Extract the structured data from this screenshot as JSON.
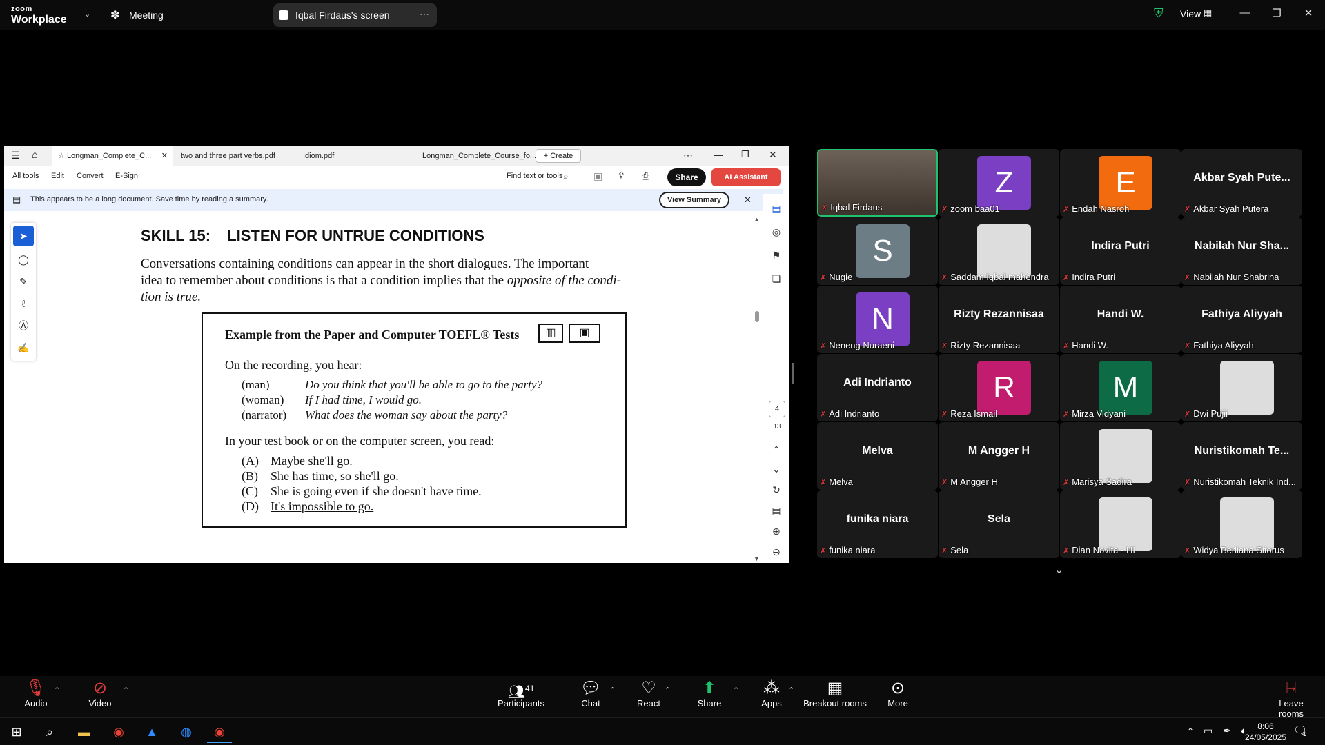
{
  "zoom": {
    "logo_line1": "zoom",
    "logo_line2": "Workplace",
    "meeting_label": "Meeting",
    "share_title": "Iqbal Firdaus's screen",
    "view_label": "View"
  },
  "acrobat": {
    "tabs": [
      "Longman_Complete_C...",
      "two and three part verbs.pdf",
      "Idiom.pdf",
      "Longman_Complete_Course_fo..."
    ],
    "create_label": "Create",
    "menu": [
      "All tools",
      "Edit",
      "Convert",
      "E-Sign"
    ],
    "find_label": "Find text or tools",
    "share_label": "Share",
    "ai_label": "AI Assistant",
    "banner_text": "This appears to be a long document. Save time by reading a summary.",
    "summary_label": "View Summary",
    "page_current": "4",
    "page_total": "13"
  },
  "document": {
    "skill_heading": "SKILL 15:",
    "skill_title": "LISTEN FOR UNTRUE CONDITIONS",
    "intro_1": "Conversations containing conditions can appear in the short dialogues. The important",
    "intro_2a": "idea to remember about conditions is that a condition implies that the ",
    "intro_2b": "opposite of the condi-",
    "intro_3": "tion is true.",
    "example_title": "Example from the Paper and Computer TOEFL® Tests",
    "recording_label": "On the recording, you hear:",
    "dialogue": [
      {
        "speaker": "(man)",
        "line": "Do you think that you'll be able to go to the party?"
      },
      {
        "speaker": "(woman)",
        "line": "If I had time, I would go."
      },
      {
        "speaker": "(narrator)",
        "line": "What does the woman say about the party?"
      }
    ],
    "read_label": "In your test book or on the computer screen, you read:",
    "options": [
      {
        "letter": "(A)",
        "text": "Maybe she'll go."
      },
      {
        "letter": "(B)",
        "text": "She has time, so she'll go."
      },
      {
        "letter": "(C)",
        "text": "She is going even if she doesn't have time."
      },
      {
        "letter": "(D)",
        "text": "It's impossible to go."
      }
    ]
  },
  "participants": [
    {
      "name": "Iqbal Firdaus",
      "type": "video"
    },
    {
      "name": "zoom baa01",
      "type": "avatar",
      "letter": "Z",
      "color": "#7b3fc4"
    },
    {
      "name": "Endah Nasroh",
      "type": "avatar",
      "letter": "E",
      "color": "#f26b0f"
    },
    {
      "name": "Akbar Syah Putera",
      "type": "text",
      "display": "Akbar Syah Pute..."
    },
    {
      "name": "Nugie",
      "type": "avatar",
      "letter": "S",
      "color": "#6d7d86"
    },
    {
      "name": "Saddam Iqbal mahendra",
      "type": "picture"
    },
    {
      "name": "Indira Putri",
      "type": "text",
      "display": "Indira Putri"
    },
    {
      "name": "Nabilah Nur Shabrina",
      "type": "text",
      "display": "Nabilah Nur Sha..."
    },
    {
      "name": "Neneng Nuraeni",
      "type": "avatar",
      "letter": "N",
      "color": "#7b3fc4"
    },
    {
      "name": "Rizty Rezannisaa",
      "type": "text",
      "display": "Rizty Rezannisaa"
    },
    {
      "name": "Handi W.",
      "type": "text",
      "display": "Handi W."
    },
    {
      "name": "Fathiya Aliyyah",
      "type": "text",
      "display": "Fathiya Aliyyah"
    },
    {
      "name": "Adi Indrianto",
      "type": "text",
      "display": "Adi Indrianto"
    },
    {
      "name": "Reza Ismail",
      "type": "avatar",
      "letter": "R",
      "color": "#c21c6e"
    },
    {
      "name": "Mirza Vidyani",
      "type": "avatar",
      "letter": "M",
      "color": "#0d6b45"
    },
    {
      "name": "Dwi Pujii",
      "type": "picture"
    },
    {
      "name": "Melva",
      "type": "text",
      "display": "Melva"
    },
    {
      "name": "M Angger H",
      "type": "text",
      "display": "M Angger H"
    },
    {
      "name": "Marisya Sadira",
      "type": "picture"
    },
    {
      "name": "Nuristikomah Teknik Ind...",
      "type": "text",
      "display": "Nuristikomah Te..."
    },
    {
      "name": "funika niara",
      "type": "text",
      "display": "funika niara"
    },
    {
      "name": "Sela",
      "type": "text",
      "display": "Sela"
    },
    {
      "name": "Dian Novita - HI",
      "type": "picture"
    },
    {
      "name": "Widya Berliana Sitorus",
      "type": "picture"
    }
  ],
  "toolbar": {
    "audio": "Audio",
    "video": "Video",
    "participants_count": "41",
    "participants": "Participants",
    "chat": "Chat",
    "react": "React",
    "share": "Share",
    "apps": "Apps",
    "breakout": "Breakout rooms",
    "more": "More",
    "leave": "Leave rooms"
  },
  "taskbar": {
    "time": "8:06",
    "date": "24/05/2025",
    "notif_count": "1"
  }
}
